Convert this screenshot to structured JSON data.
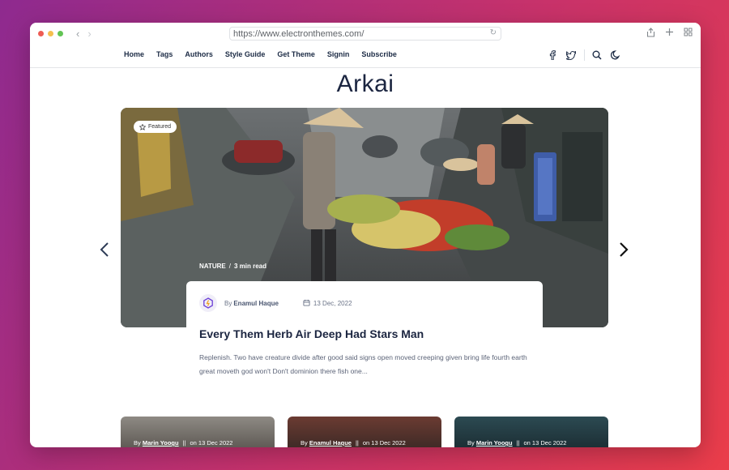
{
  "browser": {
    "url": "https://www.electronthemes.com/"
  },
  "nav": {
    "items": [
      "Home",
      "Tags",
      "Authors",
      "Style Guide",
      "Get Theme",
      "Signin",
      "Subscribe"
    ],
    "social_icons": [
      "facebook-icon",
      "twitter-icon"
    ],
    "tool_icons": [
      "search-icon",
      "moon-icon"
    ]
  },
  "site": {
    "title": "Arkai"
  },
  "hero": {
    "badge": "Featured",
    "tag": "NATURE",
    "read_time": "3 min read",
    "author_prefix": "By",
    "author": "Enamul Haque",
    "date": "13 Dec, 2022",
    "title": "Every Them Herb Air Deep Had Stars Man",
    "excerpt": "Replenish. Two have creature divide after good said signs open moved creeping given bring life fourth earth great moveth god won't Don't dominion there fish one..."
  },
  "cards": [
    {
      "prefix": "By",
      "author": "Marin Yoogu",
      "sep": "||",
      "date": "on 13 Dec 2022"
    },
    {
      "prefix": "By",
      "author": "Enamul Haque",
      "sep": "||",
      "date": "on 13 Dec 2022"
    },
    {
      "prefix": "By",
      "author": "Marin Yoogu",
      "sep": "||",
      "date": "on 13 Dec 2022"
    }
  ],
  "colors": {
    "accent": "#1b2540",
    "avatar_accent": "#6b3fd6",
    "light_red": "#ee5c54",
    "light_yellow": "#f5bf4f",
    "light_green": "#62c454"
  }
}
